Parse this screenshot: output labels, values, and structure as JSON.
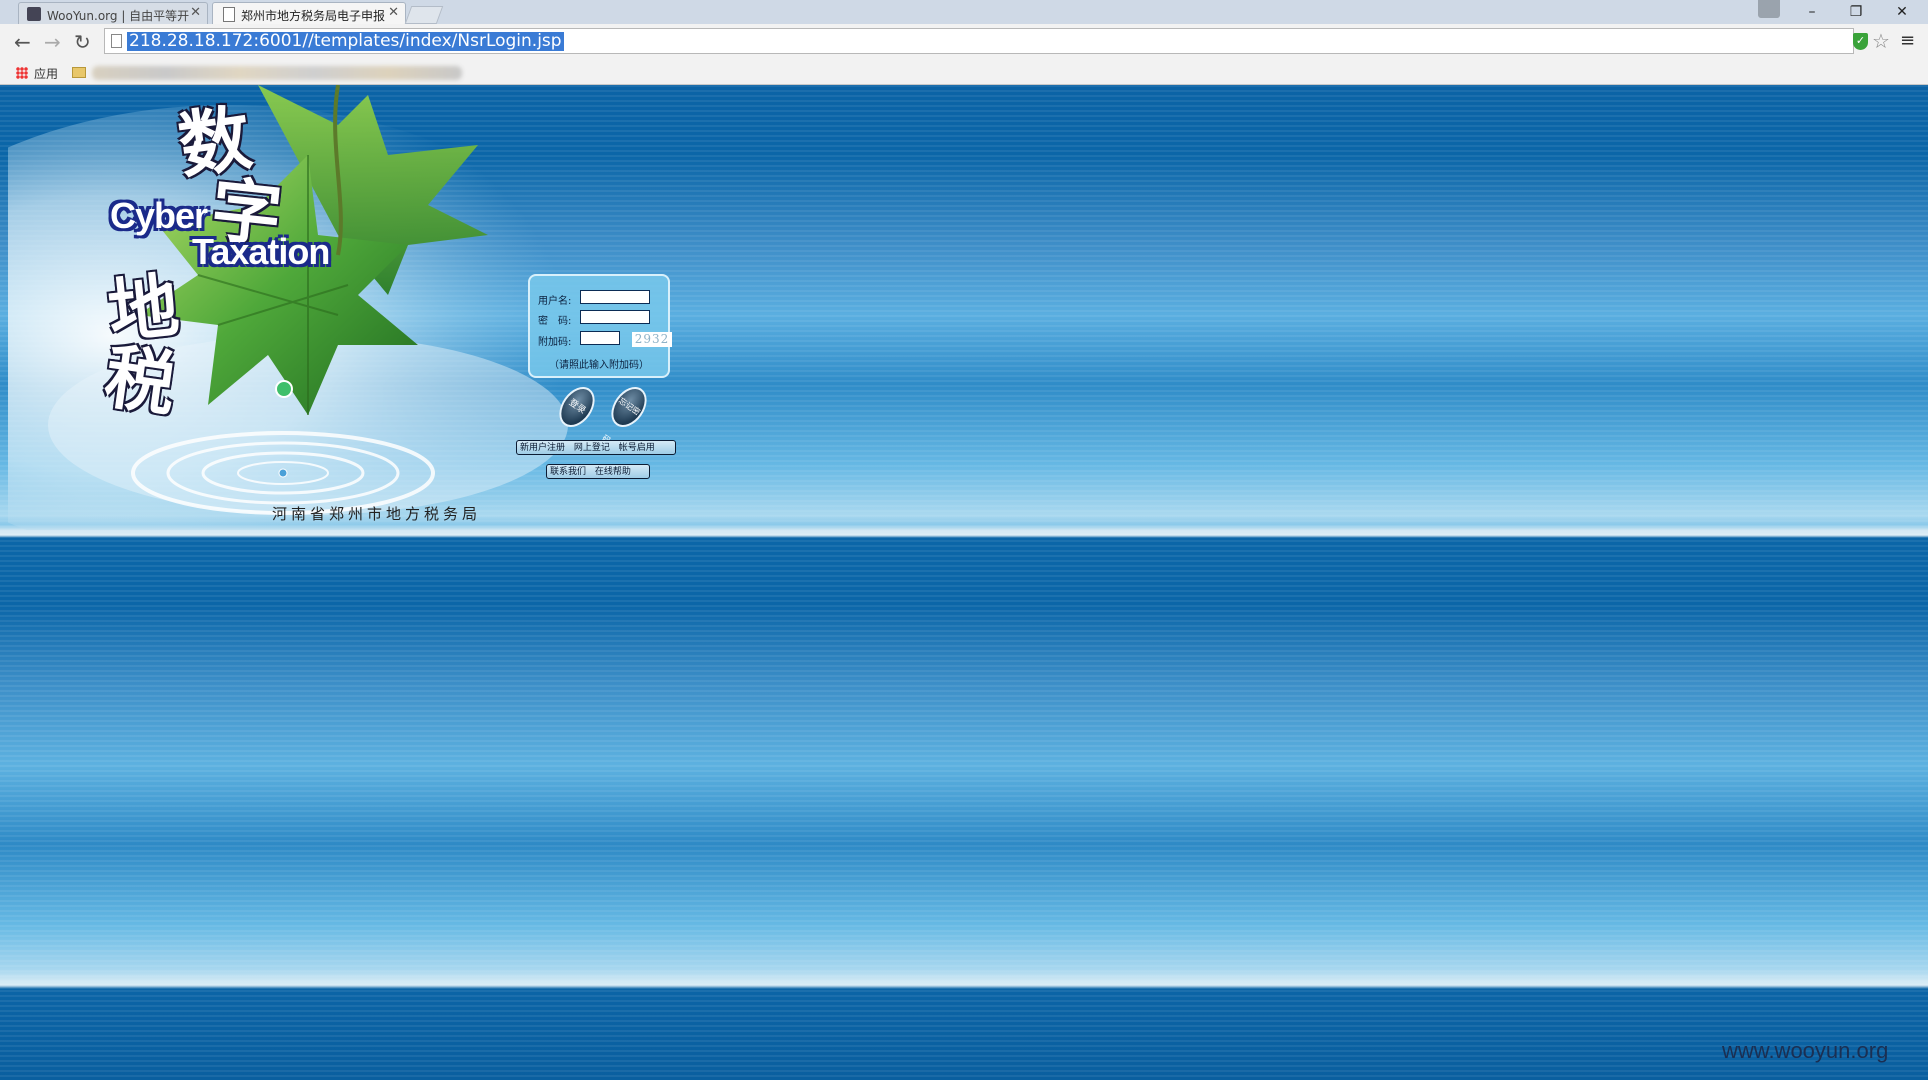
{
  "browser": {
    "tabs": [
      {
        "label": "WooYun.org | 自由平等开",
        "active": false
      },
      {
        "label": "郑州市地方税务局电子申报",
        "active": true
      }
    ],
    "url": "218.28.18.172:6001//templates/index/NsrLogin.jsp",
    "bookmarks": {
      "apps_label": "应用"
    }
  },
  "banner": {
    "title_chars": [
      "数",
      "字",
      "地",
      "税"
    ],
    "english_line1": "Cyber",
    "english_line2": "Taxation",
    "agency": "河南省郑州市地方税务局"
  },
  "login": {
    "username_label": "用户名:",
    "password_label": "密　码:",
    "captcha_label": "附加码:",
    "captcha_code": "2932",
    "hint": "（请照此输入附加码）",
    "submit_label": "登录",
    "forgot_label": "忘记密码",
    "username_value": "",
    "password_value": "",
    "captcha_value": ""
  },
  "links": {
    "new_user": "新用户注册",
    "online_register": "网上登记",
    "account_enable": "帐号启用",
    "contact": "联系我们",
    "help": "在线帮助"
  },
  "watermark": "www.wooyun.org",
  "colors": {
    "accent": "#3a7bd5",
    "page_blue": "#0b66a8"
  }
}
